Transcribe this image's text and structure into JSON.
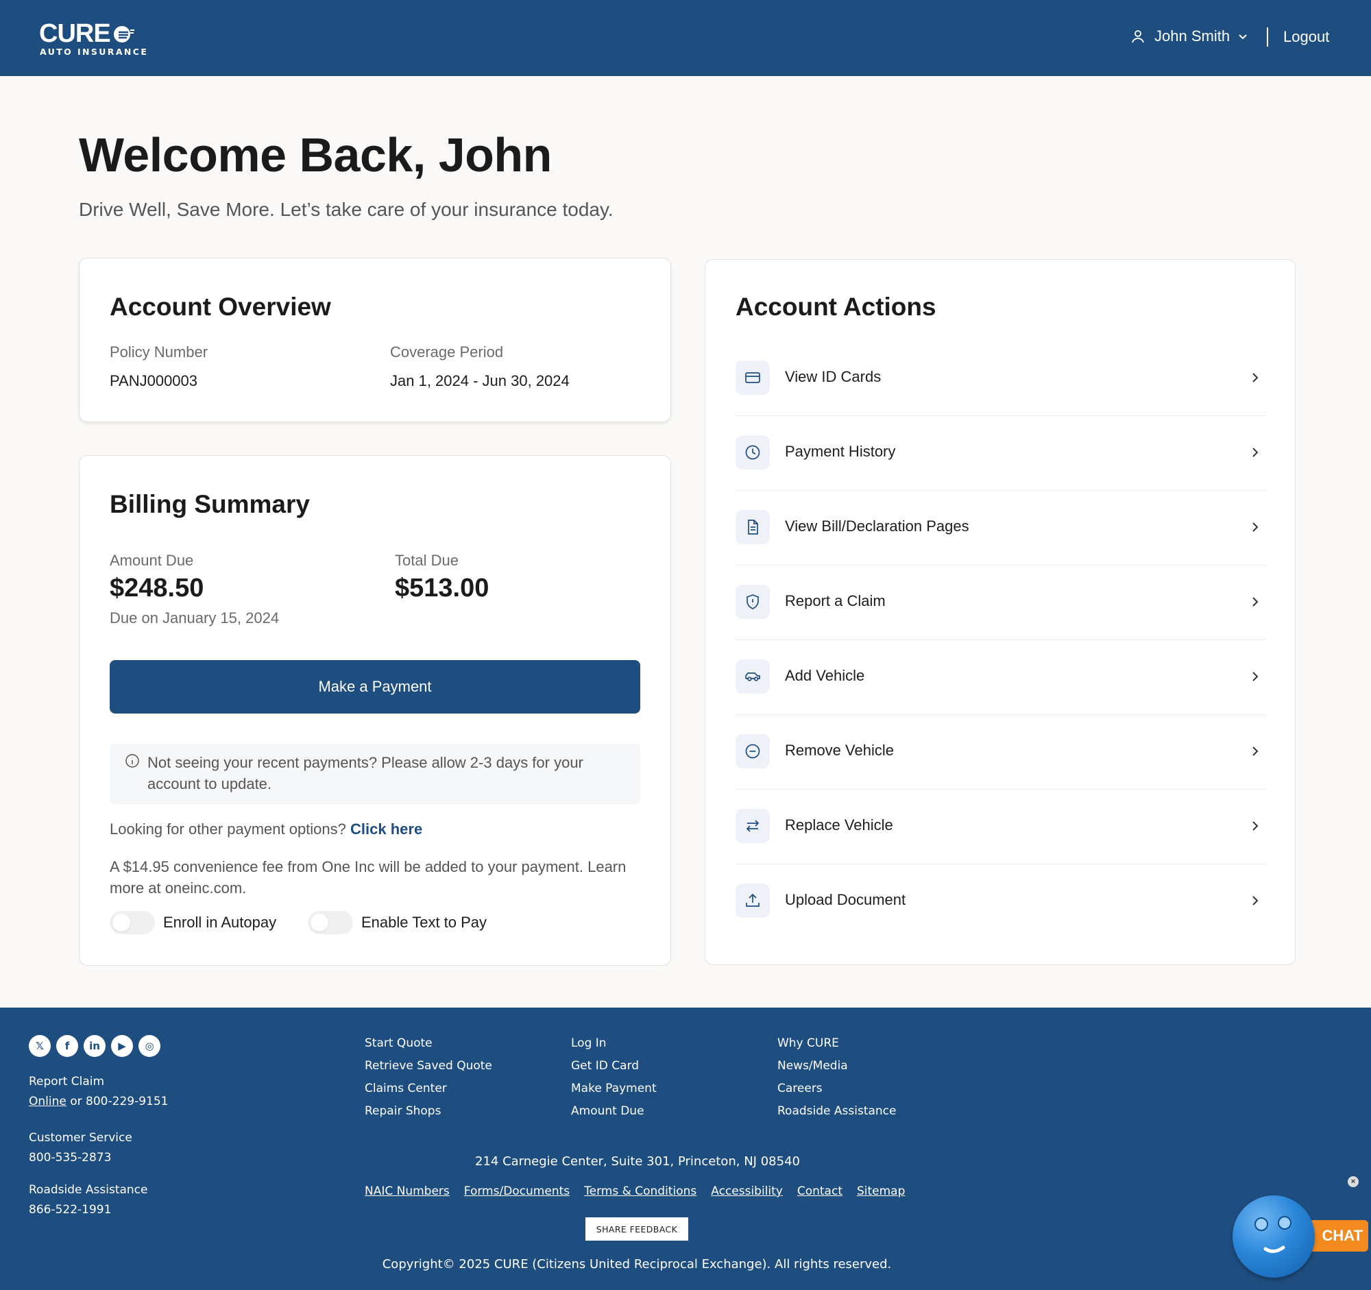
{
  "header": {
    "logo_text": "CURE",
    "logo_sub": "AUTO INSURANCE",
    "user_name": "John Smith",
    "logout_label": "Logout"
  },
  "hero": {
    "title": "Welcome Back, John",
    "tagline": "Drive Well, Save More. Let’s take care of your insurance today."
  },
  "overview": {
    "title": "Account Overview",
    "policy_label": "Policy Number",
    "policy_value": "PANJ000003",
    "coverage_label": "Coverage Period",
    "coverage_value": "Jan 1, 2024 - Jun 30, 2024"
  },
  "billing": {
    "title": "Billing Summary",
    "amount_due_label": "Amount Due",
    "amount_due_value": "$248.50",
    "due_date": "Due on January 15, 2024",
    "total_due_label": "Total Due",
    "total_due_value": "$513.00",
    "pay_button": "Make a Payment",
    "notice": "Not seeing your recent payments? Please allow 2-3 days for your account to update.",
    "other_options_text": "Looking for other payment options?",
    "other_options_link": "Click here",
    "fee_text": "A $14.95 convenience fee from One Inc will be added to your payment. Learn more at oneinc.com.",
    "autopay_label": "Enroll in Autopay",
    "text_to_pay_label": "Enable Text to Pay"
  },
  "actions": {
    "title": "Account Actions",
    "items": [
      {
        "label": "View ID Cards",
        "icon": "id-card-icon"
      },
      {
        "label": "Payment History",
        "icon": "clock-icon"
      },
      {
        "label": "View Bill/Declaration Pages",
        "icon": "document-icon"
      },
      {
        "label": "Report a Claim",
        "icon": "shield-alert-icon"
      },
      {
        "label": "Add Vehicle",
        "icon": "car-icon"
      },
      {
        "label": "Remove Vehicle",
        "icon": "minus-circle-icon"
      },
      {
        "label": "Replace Vehicle",
        "icon": "swap-arrows-icon"
      },
      {
        "label": "Upload Document",
        "icon": "upload-icon"
      }
    ]
  },
  "footer": {
    "socials": [
      "x-icon",
      "facebook-icon",
      "linkedin-icon",
      "youtube-icon",
      "instagram-icon"
    ],
    "report_claim_label": "Report Claim",
    "report_claim_online": "Online",
    "report_claim_phone": " or 800-229-9151",
    "customer_service_label": "Customer Service",
    "customer_service_phone": "800-535-2873",
    "roadside_label": "Roadside Assistance",
    "roadside_phone": "866-522-1991",
    "col1": [
      "Start Quote",
      "Retrieve Saved Quote",
      "Claims Center",
      "Repair Shops"
    ],
    "col2": [
      "Log In",
      "Get ID Card",
      "Make Payment",
      "Amount Due"
    ],
    "col3": [
      "Why CURE",
      "News/Media",
      "Careers",
      "Roadside Assistance"
    ],
    "address": "214 Carnegie Center, Suite 301, Princeton, NJ 08540",
    "links": [
      "NAIC Numbers",
      "Forms/Documents",
      "Terms & Conditions",
      "Accessibility",
      "Contact",
      "Sitemap"
    ],
    "feedback_button": "SHARE FEEDBACK",
    "copyright": "Copyright© 2025 CURE (Citizens United Reciprocal Exchange). All rights reserved."
  },
  "chat": {
    "label": "CHAT",
    "close": "×"
  },
  "colors": {
    "brand_blue": "#1e4d80",
    "chat_orange": "#f28a1d"
  }
}
